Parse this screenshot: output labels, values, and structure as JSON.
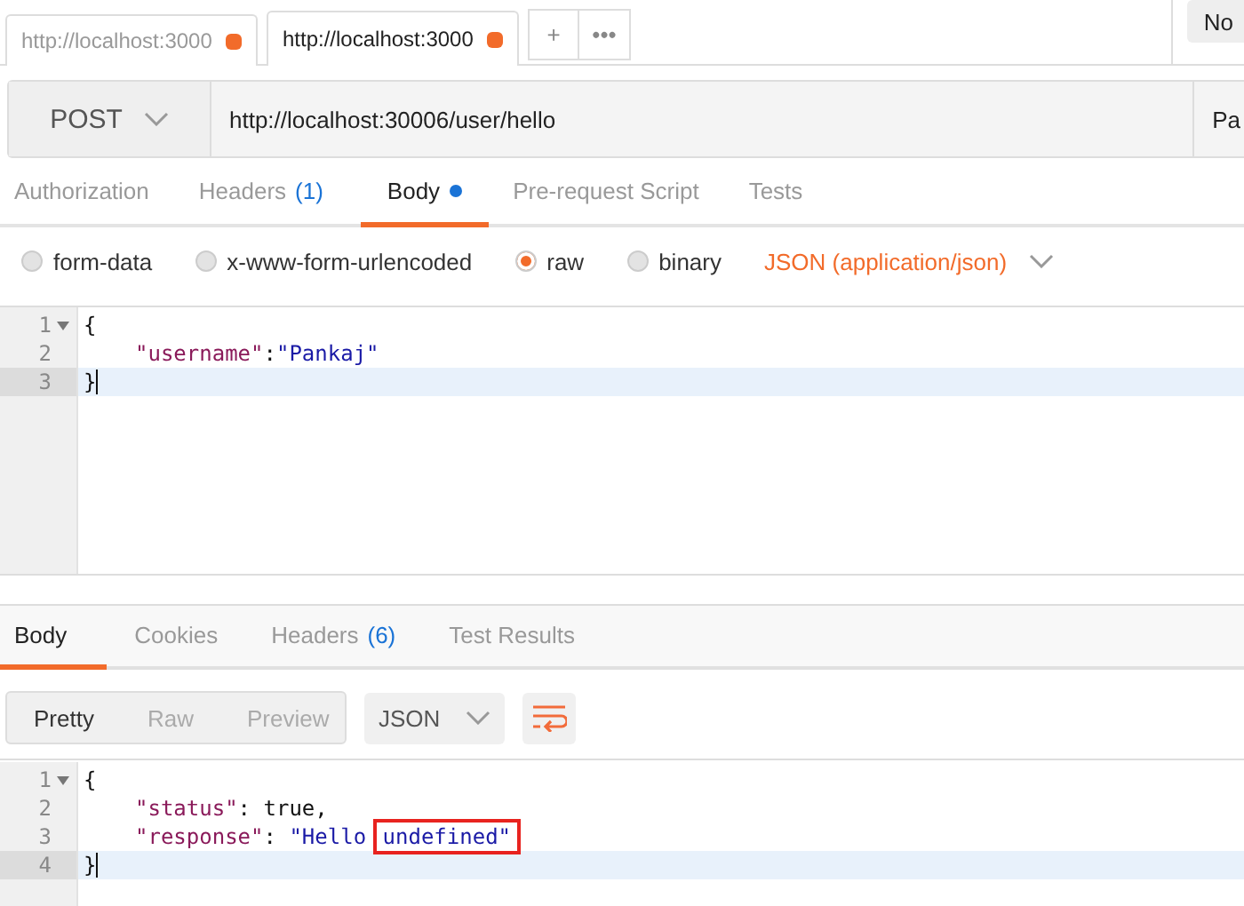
{
  "tabs": [
    {
      "label": "http://localhost:3000",
      "selected": false,
      "unsaved": true
    },
    {
      "label": "http://localhost:3000",
      "selected": true,
      "unsaved": true
    }
  ],
  "tab_actions": [
    "+",
    "•••"
  ],
  "corner_button": {
    "label": "No"
  },
  "request": {
    "method": "POST",
    "url": "http://localhost:30006/user/hello",
    "side_button": "Pa"
  },
  "request_tabs": [
    {
      "label": "Authorization",
      "dot": false,
      "selected": false
    },
    {
      "label": "Headers",
      "count": "(1)",
      "dot": false,
      "selected": false
    },
    {
      "label": "Body",
      "dot": true,
      "selected": true
    },
    {
      "label": "Pre-request Script",
      "dot": false,
      "selected": false
    },
    {
      "label": "Tests",
      "dot": false,
      "selected": false
    }
  ],
  "body_modes": [
    {
      "label": "form-data",
      "selected": false
    },
    {
      "label": "x-www-form-urlencoded",
      "selected": false
    },
    {
      "label": "raw",
      "selected": true
    },
    {
      "label": "binary",
      "selected": false
    }
  ],
  "content_type": "JSON (application/json)",
  "request_body": [
    {
      "number": "1",
      "fold": true,
      "active": false,
      "indented": false,
      "tokens": [
        {
          "kind": "punct",
          "text": "{",
          "boxed": false
        }
      ]
    },
    {
      "number": "2",
      "fold": false,
      "active": false,
      "indented": true,
      "tokens": [
        {
          "kind": "key",
          "text": "\"username\"",
          "boxed": false
        },
        {
          "kind": "punct",
          "text": ":",
          "boxed": false
        },
        {
          "kind": "string",
          "text": "\"Pankaj\"",
          "boxed": false
        }
      ]
    },
    {
      "number": "3",
      "fold": false,
      "active": true,
      "indented": false,
      "tokens": [
        {
          "kind": "punct",
          "text": "}",
          "boxed": false
        }
      ]
    }
  ],
  "response_tabs": [
    {
      "label": "Body",
      "selected": true
    },
    {
      "label": "Cookies",
      "selected": false
    },
    {
      "label": "Headers",
      "count": "(6)",
      "selected": false
    },
    {
      "label": "Test Results",
      "selected": false
    }
  ],
  "view_modes": [
    {
      "label": "Pretty",
      "selected": true
    },
    {
      "label": "Raw",
      "selected": false
    },
    {
      "label": "Preview",
      "selected": false
    }
  ],
  "format": "JSON",
  "response_body": [
    {
      "number": "1",
      "fold": true,
      "active": false,
      "indented": false,
      "tokens": [
        {
          "kind": "punct",
          "text": "{",
          "boxed": false
        }
      ]
    },
    {
      "number": "2",
      "fold": false,
      "active": false,
      "indented": true,
      "tokens": [
        {
          "kind": "key",
          "text": "\"status\"",
          "boxed": false
        },
        {
          "kind": "punct",
          "text": ": ",
          "boxed": false
        },
        {
          "kind": "bool",
          "text": "true",
          "boxed": false
        },
        {
          "kind": "punct",
          "text": ",",
          "boxed": false
        }
      ]
    },
    {
      "number": "3",
      "fold": false,
      "active": false,
      "indented": true,
      "tokens": [
        {
          "kind": "key",
          "text": "\"response\"",
          "boxed": false
        },
        {
          "kind": "punct",
          "text": ": ",
          "boxed": false
        },
        {
          "kind": "string",
          "text": "\"Hello ",
          "boxed": false
        },
        {
          "kind": "string",
          "text": "undefined\"",
          "boxed": true
        }
      ]
    },
    {
      "number": "4",
      "fold": false,
      "active": true,
      "indented": false,
      "tokens": [
        {
          "kind": "punct",
          "text": "}",
          "boxed": false
        }
      ]
    }
  ]
}
